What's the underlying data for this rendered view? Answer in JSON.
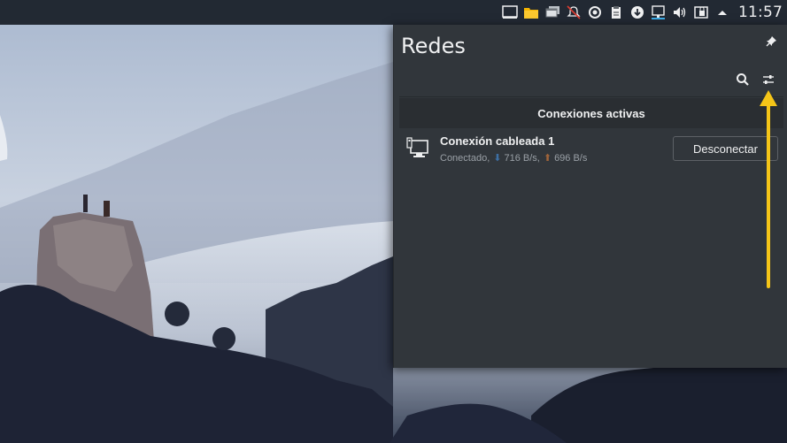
{
  "taskbar": {
    "clock": "11:57",
    "tray_icons": [
      "desktop-icon",
      "folder-icon",
      "windows-icon",
      "notifications-off-icon",
      "settings-sync-icon",
      "clipboard-icon",
      "download-icon",
      "network-icon",
      "volume-icon",
      "vault-icon",
      "expand-tray-icon"
    ]
  },
  "popup": {
    "title": "Redes",
    "section_header": "Conexiones activas",
    "connection": {
      "name": "Conexión cableada 1",
      "status_label": "Conectado,",
      "download_speed": "716 B/s,",
      "upload_speed": "696 B/s",
      "disconnect_label": "Desconectar"
    }
  },
  "colors": {
    "panel_background": "#31363b",
    "text": "#eff0f1",
    "annotation": "#f5c518"
  }
}
